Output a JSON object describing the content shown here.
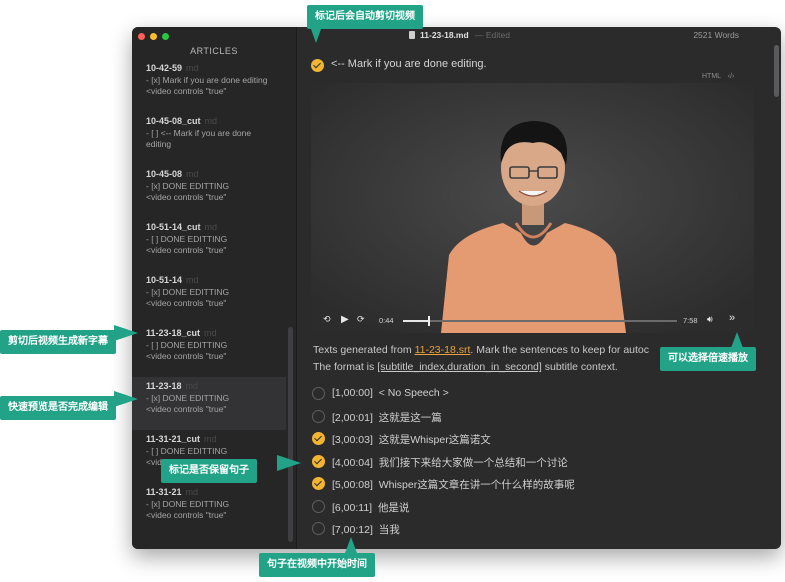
{
  "app": {
    "sidebar_title": "ARTICLES",
    "doc_title": "11-23-18.md",
    "doc_status": "— Edited",
    "word_count": "2521 Words"
  },
  "sidebar": {
    "files": [
      {
        "name": "10-42-59",
        "ext": "md",
        "lines": [
          "- [x] Mark if you are done editing",
          "<video controls \"true\""
        ]
      },
      {
        "name": "10-45-08_cut",
        "ext": "md",
        "lines": [
          "- [ ] <-- Mark if you are done",
          "editing"
        ]
      },
      {
        "name": "10-45-08",
        "ext": "md",
        "lines": [
          "- [x] DONE EDITTING",
          "<video controls \"true\""
        ]
      },
      {
        "name": "10-51-14_cut",
        "ext": "md",
        "lines": [
          "- [ ] DONE EDITTING",
          "<video controls \"true\""
        ]
      },
      {
        "name": "10-51-14",
        "ext": "md",
        "lines": [
          "- [x] DONE EDITTING",
          "<video controls \"true\""
        ]
      },
      {
        "name": "11-23-18_cut",
        "ext": "md",
        "lines": [
          "- [ ] DONE EDITTING",
          "<video controls \"true\""
        ]
      },
      {
        "name": "11-23-18",
        "ext": "md",
        "lines": [
          "- [x] DONE EDITTING",
          "<video controls \"true\""
        ]
      },
      {
        "name": "11-31-21_cut",
        "ext": "md",
        "lines": [
          "- [ ] DONE EDITTING",
          "<video controls \"true\""
        ]
      },
      {
        "name": "11-31-21",
        "ext": "md",
        "lines": [
          "- [x] DONE EDITTING",
          "<video controls \"true\""
        ]
      }
    ]
  },
  "editor": {
    "mark_text": "<-- Mark if you are done editing.",
    "html_tag": "HTML",
    "video": {
      "current_time": "0:44",
      "duration": "7:58",
      "progress": 0.092
    },
    "para1_prefix": "Texts generated from ",
    "para1_link": "11-23-18.srt",
    "para1_suffix": ". Mark the sentences to keep for autoc",
    "para2_prefix": "The format is ",
    "para2_code": "[subtitle_index,duration_in_second]",
    "para2_suffix": " subtitle context.",
    "subtitles": [
      {
        "index": "[1,00:00]",
        "text": "< No Speech >",
        "checked": false
      },
      {
        "index": "[2,00:01]",
        "text": "这就是这一篇",
        "checked": false
      },
      {
        "index": "[3,00:03]",
        "text": "这就是Whisper这篇诺文",
        "checked": true
      },
      {
        "index": "[4,00:04]",
        "text": "我们接下来给大家做一个总结和一个讨论",
        "checked": true
      },
      {
        "index": "[5,00:08]",
        "text": "Whisper这篇文章在讲一个什么样的故事呢",
        "checked": true
      },
      {
        "index": "[6,00:11]",
        "text": "他是说",
        "checked": false
      },
      {
        "index": "[7,00:12]",
        "text": "当我",
        "checked": false
      }
    ]
  },
  "callouts": {
    "top": "标记后会自动剪切视频",
    "cut_subtitle": "剪切后视频生成新字幕",
    "preview": "快速预览是否完成编辑",
    "speed": "可以选择倍速播放",
    "keep": "标记是否保留句子",
    "start_time": "句子在视频中开始时间"
  },
  "colors": {
    "accent": "#f2b431",
    "callout": "#22a387",
    "link": "#e9a23b"
  }
}
